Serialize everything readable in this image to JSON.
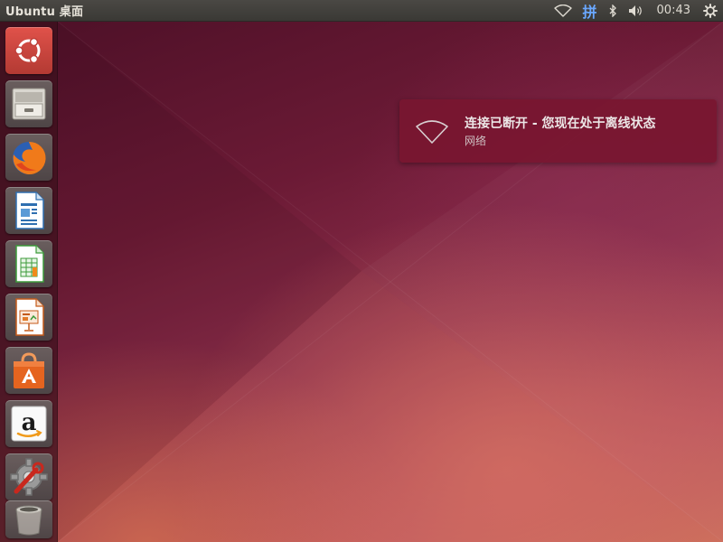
{
  "top_panel": {
    "title": "Ubuntu 桌面",
    "indicators": {
      "network_icon": "wifi-icon",
      "input_method": "拼",
      "bluetooth_icon": "bluetooth-icon",
      "sound_icon": "volume-icon",
      "clock": "00:43",
      "session_icon": "gear-icon"
    }
  },
  "launcher": {
    "items": [
      {
        "name": "dash-home",
        "icon": "ubuntu-logo-icon"
      },
      {
        "name": "files",
        "icon": "file-cabinet-icon"
      },
      {
        "name": "firefox",
        "icon": "firefox-icon"
      },
      {
        "name": "libreoffice-writer",
        "icon": "writer-icon"
      },
      {
        "name": "libreoffice-calc",
        "icon": "calc-icon"
      },
      {
        "name": "libreoffice-impress",
        "icon": "impress-icon"
      },
      {
        "name": "ubuntu-software",
        "icon": "software-bag-icon"
      },
      {
        "name": "amazon",
        "icon": "amazon-icon"
      },
      {
        "name": "system-settings",
        "icon": "settings-wrench-icon"
      },
      {
        "name": "trash",
        "icon": "trash-icon"
      }
    ]
  },
  "notification": {
    "icon": "wifi-disconnected-icon",
    "title": "连接已断开 - 您现在处于离线状态",
    "body": "网络"
  },
  "colors": {
    "panel_bg": "#3c3b37",
    "notification_bg": "#78162f",
    "ime_accent": "#6aa8ff"
  }
}
